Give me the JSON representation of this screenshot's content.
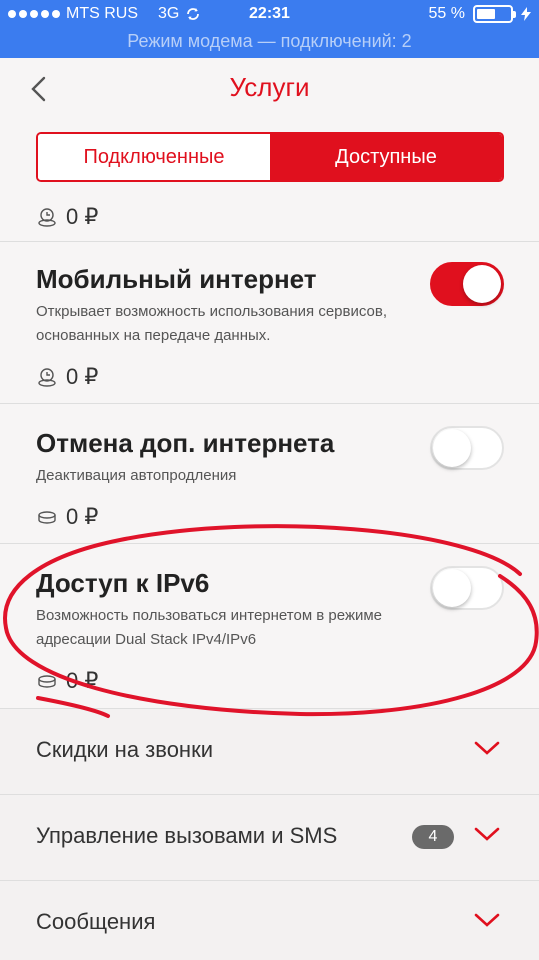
{
  "status_bar": {
    "carrier": "MTS RUS",
    "network": "3G",
    "time": "22:31",
    "battery_percent": "55 %",
    "battery_level": 0.55,
    "hotspot_text": "Режим модема — подключений: 2"
  },
  "header": {
    "title": "Услуги",
    "tabs": [
      {
        "label": "Подключенные",
        "active": false
      },
      {
        "label": "Доступные",
        "active": true
      }
    ]
  },
  "services": [
    {
      "title": "",
      "description": "",
      "price": "0 ₽"
    },
    {
      "title": "Мобильный интернет",
      "description": "Открывает возможность использования сервисов, основанных на передаче данных.",
      "price": "0 ₽",
      "enabled": true
    },
    {
      "title": "Отмена доп. интернета",
      "description": "Деактивация автопродления",
      "price": "0 ₽",
      "enabled": false
    },
    {
      "title": "Доступ к IPv6",
      "description": "Возможность пользоваться интернетом в режиме адресации Dual Stack IPv4/IPv6",
      "price": "0 ₽",
      "enabled": false
    }
  ],
  "sections": [
    {
      "label": "Скидки на звонки"
    },
    {
      "label": "Управление вызовами и SMS",
      "badge": "4"
    },
    {
      "label": "Сообщения"
    }
  ],
  "colors": {
    "accent": "#e0101e",
    "status_bar": "#3b7cef",
    "annotation": "#e0132a"
  }
}
